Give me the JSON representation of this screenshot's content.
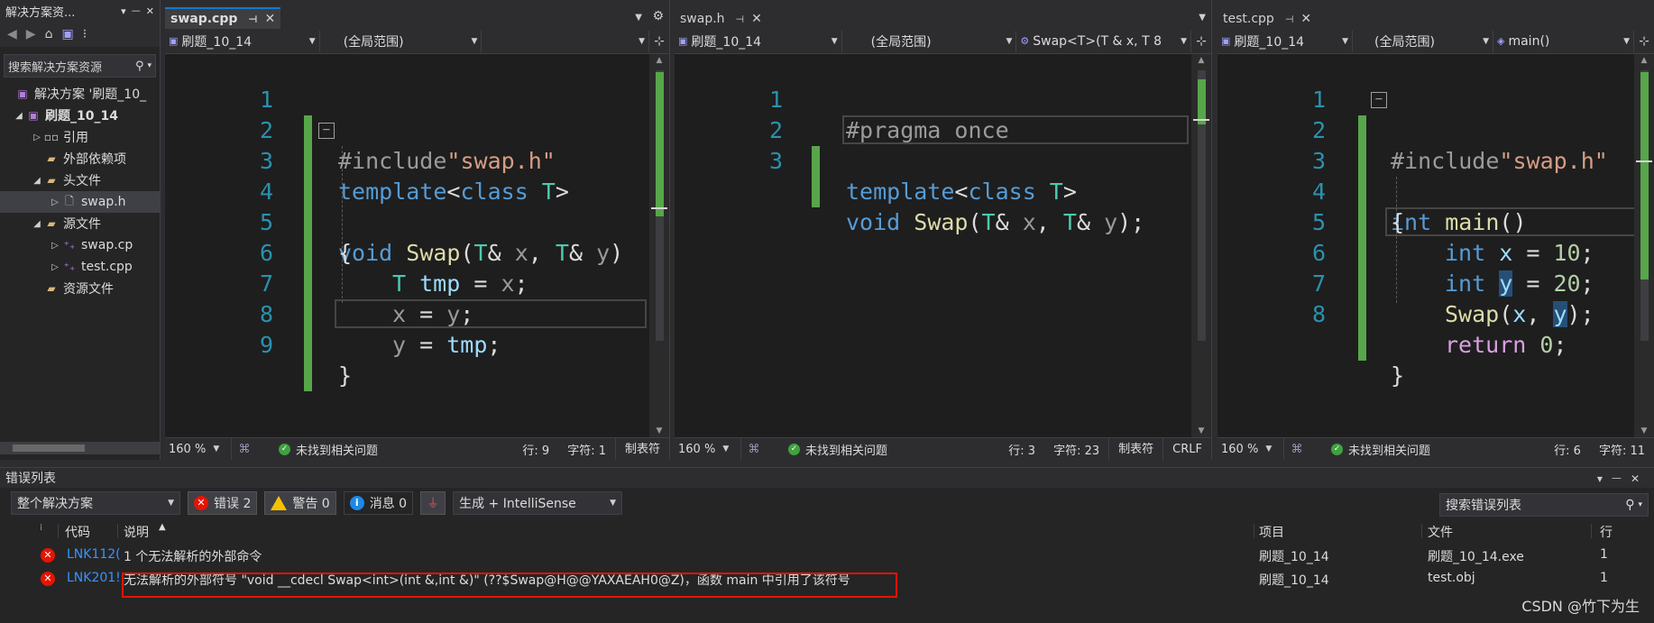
{
  "solution_explorer": {
    "title": "解决方案资...",
    "search_placeholder": "搜索解决方案资源",
    "tree": [
      {
        "label": "解决方案 '刷题_10_"
      },
      {
        "label": "刷题_10_14"
      },
      {
        "label": "引用"
      },
      {
        "label": "外部依赖项"
      },
      {
        "label": "头文件"
      },
      {
        "label": "swap.h"
      },
      {
        "label": "源文件"
      },
      {
        "label": "swap.cp"
      },
      {
        "label": "test.cpp"
      },
      {
        "label": "资源文件"
      }
    ]
  },
  "panes": [
    {
      "tab": "swap.cpp",
      "nav": [
        "刷题_10_14",
        "(全局范围)"
      ],
      "line_numbers": [
        "1",
        "2",
        "3",
        "4",
        "5",
        "6",
        "7",
        "8",
        "9"
      ],
      "code": {
        "l1a": "#include",
        "l1b": "\"swap.h\"",
        "l2a": "template",
        "l2b": "<",
        "l2c": "class",
        "l2d": " T",
        "l2e": ">",
        "l3a": "void",
        "l3b": " Swap",
        "l3c": "(",
        "l3d": "T",
        "l3e": "& ",
        "l3f": "x",
        "l3g": ", ",
        "l3h": "T",
        "l3i": "& ",
        "l3j": "y",
        "l3k": ")",
        "l4": "{",
        "l5a": "T",
        "l5b": " ",
        "l5c": "tmp",
        "l5d": " = ",
        "l5e": "x",
        "l5f": ";",
        "l6a": "x",
        "l6b": " = ",
        "l6c": "y",
        "l6d": ";",
        "l7a": "y",
        "l7b": " = ",
        "l7c": "tmp",
        "l7d": ";",
        "l8": "}"
      },
      "status": {
        "zoom": "160 %",
        "message": "未找到相关问题",
        "row": "行: 9",
        "col": "字符: 1",
        "tab": "制表符"
      }
    },
    {
      "tab": "swap.h",
      "nav": [
        "刷题_10_14",
        "(全局范围)",
        "Swap<T>(T & x, T 8"
      ],
      "line_numbers": [
        "1",
        "2",
        "3"
      ],
      "code": {
        "l1a": "#pragma",
        "l1b": " once",
        "l2a": "template",
        "l2b": "<",
        "l2c": "class",
        "l2d": " T",
        "l2e": ">",
        "l3a": "void",
        "l3b": " Swap",
        "l3c": "(",
        "l3d": "T",
        "l3e": "& ",
        "l3f": "x",
        "l3g": ", ",
        "l3h": "T",
        "l3i": "& ",
        "l3j": "y",
        "l3k": ");"
      },
      "status": {
        "zoom": "160 %",
        "message": "未找到相关问题",
        "row": "行: 3",
        "col": "字符: 23",
        "tab": "制表符",
        "eol": "CRLF"
      }
    },
    {
      "tab": "test.cpp",
      "nav": [
        "刷题_10_14",
        "(全局范围)",
        "main()"
      ],
      "line_numbers": [
        "1",
        "2",
        "3",
        "4",
        "5",
        "6",
        "7",
        "8"
      ],
      "code": {
        "l1a": "#include",
        "l1b": "\"swap.h\"",
        "l2a": "int",
        "l2b": " main",
        "l2c": "()",
        "l3": "{",
        "l4a": "int",
        "l4b": " x",
        "l4c": " = ",
        "l4d": "10",
        "l4e": ";",
        "l5a": "int",
        "l5b": " ",
        "l5c": "y",
        "l5d": " = ",
        "l5e": "20",
        "l5f": ";",
        "l6a": "Swap",
        "l6b": "(",
        "l6c": "x",
        "l6d": ", ",
        "l6e": "y",
        "l6f": ");",
        "l7a": "return",
        "l7b": " 0",
        "l7c": ";",
        "l8": "}"
      },
      "status": {
        "zoom": "160 %",
        "message": "未找到相关问题",
        "row": "行: 6",
        "col": "字符: 11"
      }
    }
  ],
  "error_list": {
    "title": "错误列表",
    "scope": "整个解决方案",
    "errors_label": "错误 2",
    "warnings_label": "警告 0",
    "messages_label": "消息 0",
    "build_filter": "生成 + IntelliSense",
    "search_placeholder": "搜索错误列表",
    "columns": {
      "code": "代码",
      "desc": "说明",
      "project": "项目",
      "file": "文件",
      "line": "行"
    },
    "rows": [
      {
        "code": "LNK112(",
        "desc": "1 个无法解析的外部命令",
        "project": "刷题_10_14",
        "file": "刷题_10_14.exe",
        "line": "1"
      },
      {
        "code": "LNK201!",
        "desc": "无法解析的外部符号 \"void __cdecl Swap<int>(int &,int &)\" (??$Swap@H@@YAXAEAH0@Z)，函数 main 中引用了该符号",
        "project": "刷题_10_14",
        "file": "test.obj",
        "line": "1"
      }
    ]
  },
  "watermark": "CSDN @竹下为生",
  "colors": {
    "accent": "#0e7ad1",
    "error": "#e51400",
    "warning": "#f4c200",
    "changed_margin": "#57a64a"
  }
}
